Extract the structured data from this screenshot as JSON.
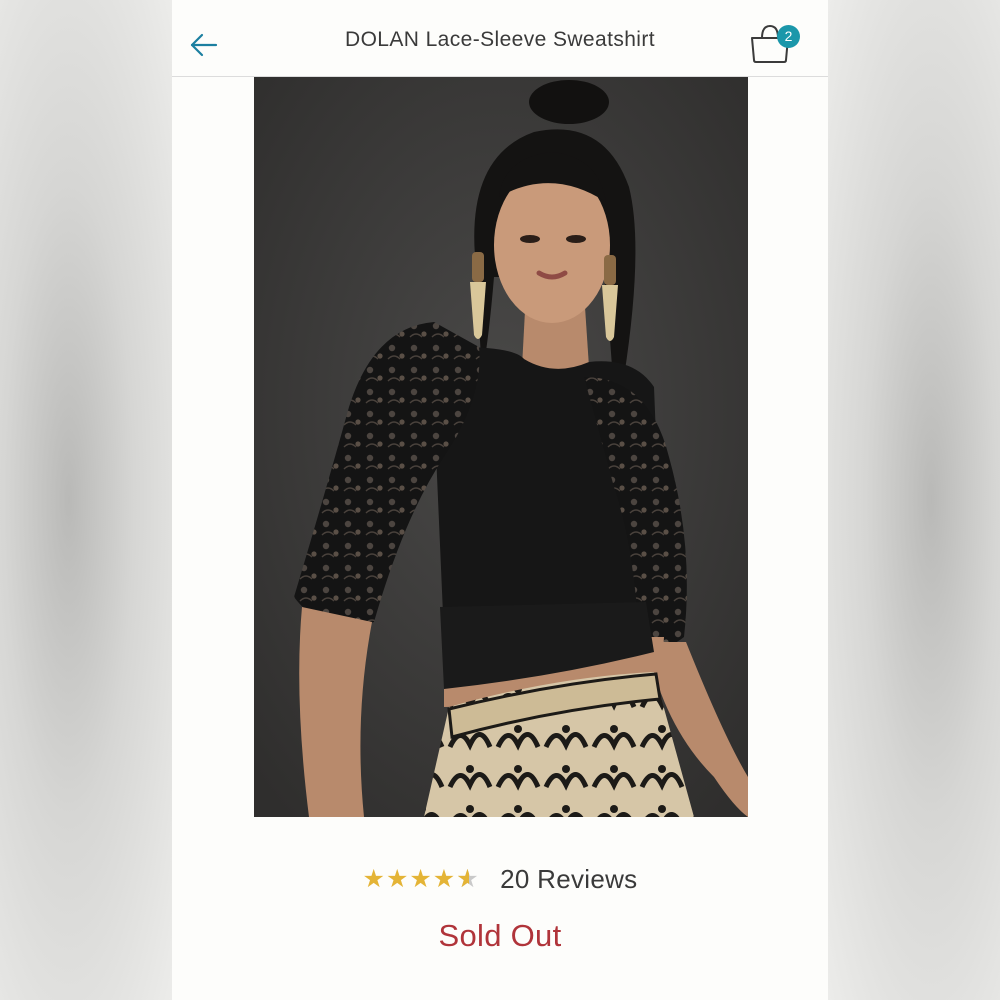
{
  "header": {
    "title": "DOLAN Lace-Sleeve Sweatshirt",
    "back_icon": "arrow-left-icon",
    "cart_icon": "shopping-bag-icon",
    "cart_count": "2"
  },
  "product": {
    "image_alt": "Model wearing black sweatshirt with lace puff sleeves",
    "rating_value": 4.5,
    "rating_max": 5,
    "reviews_label": "20 Reviews",
    "availability": "Sold Out"
  },
  "colors": {
    "accent": "#1b97aa",
    "star": "#e4b436",
    "sold_out": "#b0343a"
  }
}
